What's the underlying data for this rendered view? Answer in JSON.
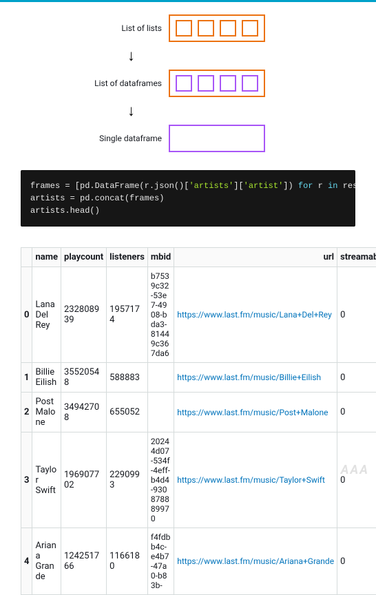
{
  "diagram": {
    "labels": {
      "list_of_lists": "List of lists",
      "list_of_dataframes": "List of dataframes",
      "single_dataframe": "Single dataframe"
    },
    "arrow_glyph": "↓"
  },
  "code": {
    "line1_a": "frames = [pd.DataFrame(r.json()[",
    "line1_str1": "'artists'",
    "line1_b": "][",
    "line1_str2": "'artist'",
    "line1_c": "]) ",
    "line1_kw_for": "for",
    "line1_d": " r ",
    "line1_kw_in": "in",
    "line1_e": " responses]",
    "line2": "artists = pd.concat(frames)",
    "line3": "artists.head()"
  },
  "table": {
    "headers": {
      "idx": "",
      "name": "name",
      "playcount": "playcount",
      "listeners": "listeners",
      "mbid": "mbid",
      "url": "url",
      "streamable": "streamable"
    },
    "rows": [
      {
        "idx": "0",
        "name": "Lana Del Rey",
        "playcount": "232808939",
        "listeners": "1957174",
        "mbid": "b7539c32-53e7-4908-bda3-81449c367da6",
        "url": "https://www.last.fm/music/Lana+Del+Rey",
        "streamable": "0"
      },
      {
        "idx": "1",
        "name": "Billie Eilish",
        "playcount": "35520548",
        "listeners": "588883",
        "mbid": "",
        "url": "https://www.last.fm/music/Billie+Eilish",
        "streamable": "0"
      },
      {
        "idx": "2",
        "name": "Post Malone",
        "playcount": "34942708",
        "listeners": "655052",
        "mbid": "",
        "url": "https://www.last.fm/music/Post+Malone",
        "streamable": "0"
      },
      {
        "idx": "3",
        "name": "Taylor Swift",
        "playcount": "196907702",
        "listeners": "2290993",
        "mbid": "20244d07-534f-4eff-b4d4-930878889970",
        "url": "https://www.last.fm/music/Taylor+Swift",
        "streamable": "0"
      },
      {
        "idx": "4",
        "name": "Ariana Grande",
        "playcount": "124251766",
        "listeners": "1166180",
        "mbid": "f4fdbb4c-e4b7-47a0-b83b-",
        "url": "https://www.last.fm/music/Ariana+Grande",
        "streamable": "0"
      }
    ]
  },
  "watermark": "AAA"
}
